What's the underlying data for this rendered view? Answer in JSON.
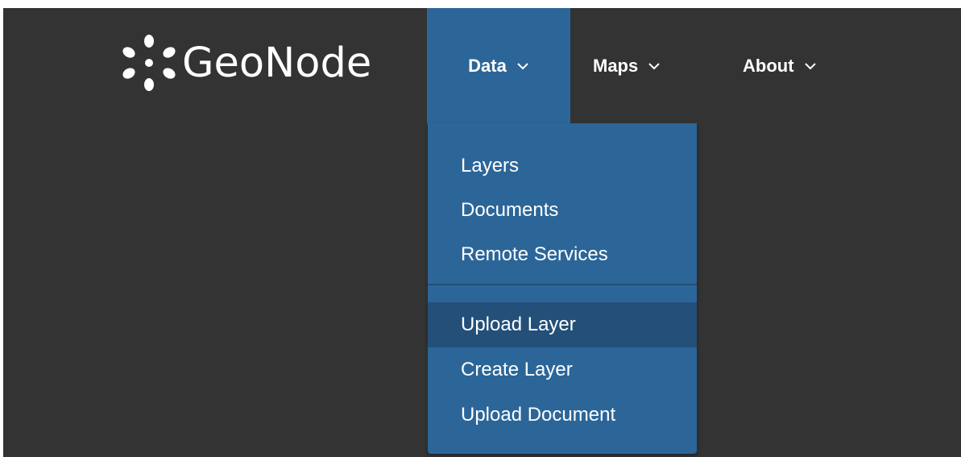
{
  "brand": {
    "name": "GeoNode",
    "icon": "geonode-logo-icon"
  },
  "nav": {
    "data_label": "Data",
    "maps_label": "Maps",
    "about_label": "About"
  },
  "dropdown": {
    "items": [
      {
        "label": "Layers"
      },
      {
        "label": "Documents"
      },
      {
        "label": "Remote Services"
      },
      {
        "label": "Upload Layer"
      },
      {
        "label": "Create Layer"
      },
      {
        "label": "Upload Document"
      }
    ],
    "highlighted_item": "Upload Layer"
  },
  "colors": {
    "navbar_bg": "#333333",
    "menu_bg": "#2c6698",
    "menu_hover": "#234f79",
    "text": "#ffffff"
  }
}
